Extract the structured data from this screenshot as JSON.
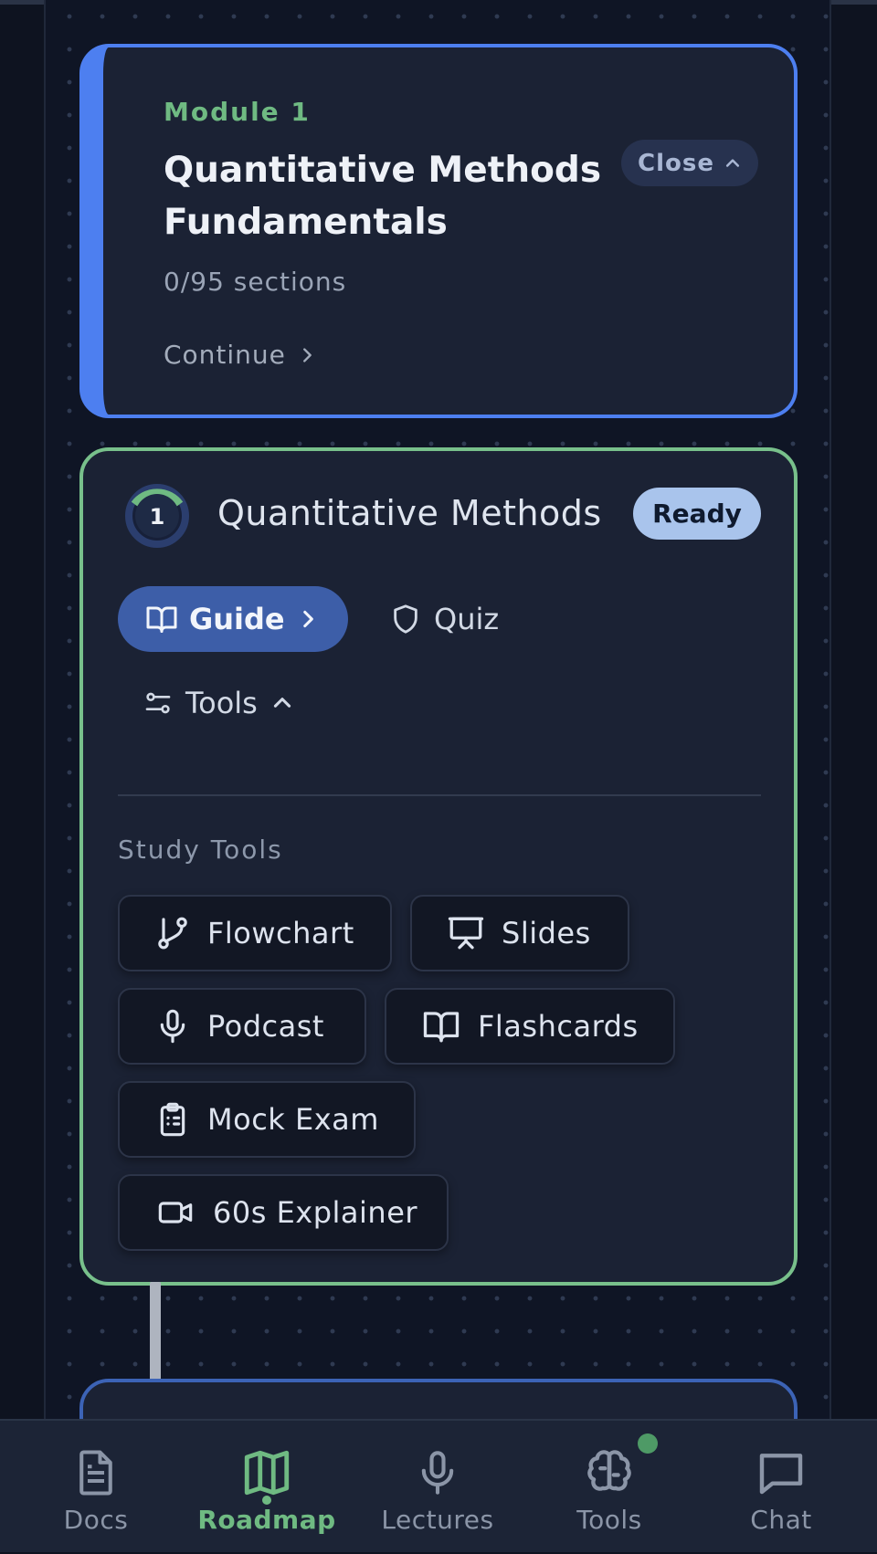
{
  "module": {
    "label": "Module 1",
    "title": "Quantitative Methods Fundamentals",
    "close_label": "Close",
    "sections_progress": "0/95 sections",
    "continue_label": "Continue"
  },
  "topic": {
    "number": "1",
    "title": "Quantitative Methods",
    "status": "Ready",
    "progress_fraction": 0.0,
    "guide_label": "Guide",
    "quiz_label": "Quiz",
    "tools_label": "Tools",
    "study_tools_heading": "Study Tools",
    "study_tools": [
      {
        "label": "Flowchart",
        "icon": "flowchart-icon"
      },
      {
        "label": "Slides",
        "icon": "presentation-icon"
      },
      {
        "label": "Podcast",
        "icon": "microphone-icon"
      },
      {
        "label": "Flashcards",
        "icon": "book-open-icon"
      },
      {
        "label": "Mock Exam",
        "icon": "clipboard-icon"
      },
      {
        "label": "60s Explainer",
        "icon": "video-icon"
      }
    ]
  },
  "bottom_nav": {
    "items": [
      {
        "label": "Docs",
        "icon": "document-icon",
        "active": false
      },
      {
        "label": "Roadmap",
        "icon": "map-icon",
        "active": true
      },
      {
        "label": "Lectures",
        "icon": "microphone-icon",
        "active": false
      },
      {
        "label": "Tools",
        "icon": "brain-icon",
        "active": false,
        "has_notification": true
      },
      {
        "label": "Chat",
        "icon": "chat-icon",
        "active": false
      }
    ]
  },
  "colors": {
    "background": "#0e1320",
    "card": "#1b2234",
    "module_border": "#4d7ff0",
    "topic_border": "#78c08b",
    "accent_green": "#6fba82",
    "guide_button": "#3d5ea8",
    "ready_badge": "#a9c4ec"
  }
}
